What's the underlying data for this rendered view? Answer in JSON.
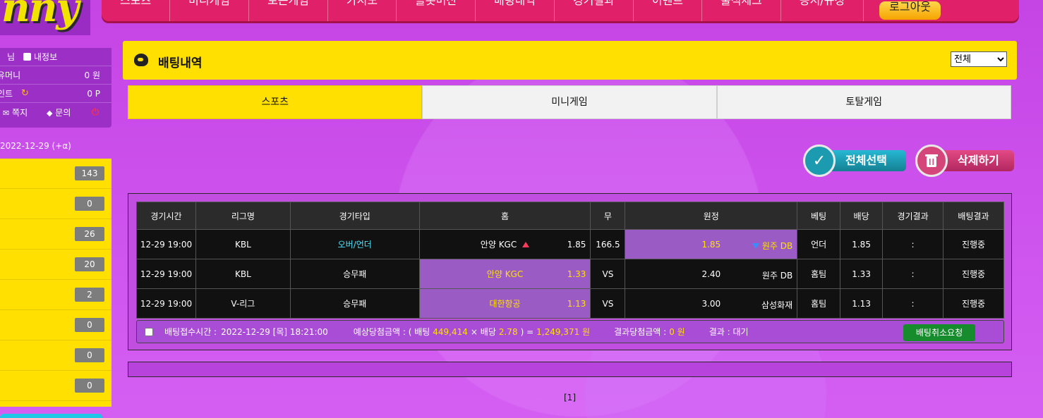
{
  "logo": {
    "text": "nny"
  },
  "nav": {
    "items": [
      "스포츠",
      "미니게임",
      "토큰게임",
      "카지노",
      "슬롯머신",
      "배팅내역",
      "경기결과",
      "이벤트",
      "출석체크",
      "공지/규정"
    ],
    "logout": "로그아웃"
  },
  "sidebar": {
    "user_suffix": "님",
    "my_info": "내정보",
    "money_label": "유머니",
    "money_value": "0 원",
    "point_label": "인트",
    "point_value": "0 P",
    "message": "쪽지",
    "inquiry": "문의",
    "date": "2022-12-29 (+α)",
    "counts": [
      "143",
      "0",
      "26",
      "20",
      "2",
      "0",
      "0",
      "0"
    ]
  },
  "page": {
    "title": "배팅내역",
    "filter_selected": "전체"
  },
  "tabs": [
    "스포츠",
    "미니게임",
    "토탈게임"
  ],
  "actions": {
    "select_all": "전체선택",
    "delete": "삭제하기"
  },
  "table": {
    "headers": [
      "경기시간",
      "리그명",
      "경기타입",
      "홈",
      "무",
      "원정",
      "베팅",
      "배당",
      "경기결과",
      "배팅결과"
    ],
    "rows": [
      {
        "time": "12-29 19:00",
        "league": "KBL",
        "type": "오버/언더",
        "home": "안양 KGC",
        "home_odd": "1.85",
        "draw": "166.5",
        "away_odd": "1.85",
        "away": "원주 DB",
        "pick": "언더",
        "odds": "1.85",
        "result": ":",
        "bet_result": "진행중"
      },
      {
        "time": "12-29 19:00",
        "league": "KBL",
        "type": "승무패",
        "home": "안양 KGC",
        "home_odd": "1.33",
        "draw": "VS",
        "away_odd": "2.40",
        "away": "원주 DB",
        "pick": "홈팀",
        "odds": "1.33",
        "result": ":",
        "bet_result": "진행중"
      },
      {
        "time": "12-29 19:00",
        "league": "V-리그",
        "type": "승무패",
        "home": "대한항공",
        "home_odd": "1.13",
        "draw": "VS",
        "away_odd": "3.00",
        "away": "삼성화재",
        "pick": "홈팀",
        "odds": "1.13",
        "result": ":",
        "bet_result": "진행중"
      }
    ]
  },
  "summary": {
    "received_label": "배팅접수시간 :",
    "received_value": "2022-12-29 [목] 18:21:00",
    "expected_label": "예상당첨금액 : ( 배팅",
    "bet_amount": "449,414",
    "times_odds": "× 배당",
    "total_odds": "2.78",
    "equals": ") =",
    "expected_amount": "1,249,371 원",
    "result_amount_label": "결과당첨금액 :",
    "result_amount": "0 원",
    "result_label": "결과 : 대기",
    "cancel": "배팅취소요청"
  },
  "pager": "[1]"
}
